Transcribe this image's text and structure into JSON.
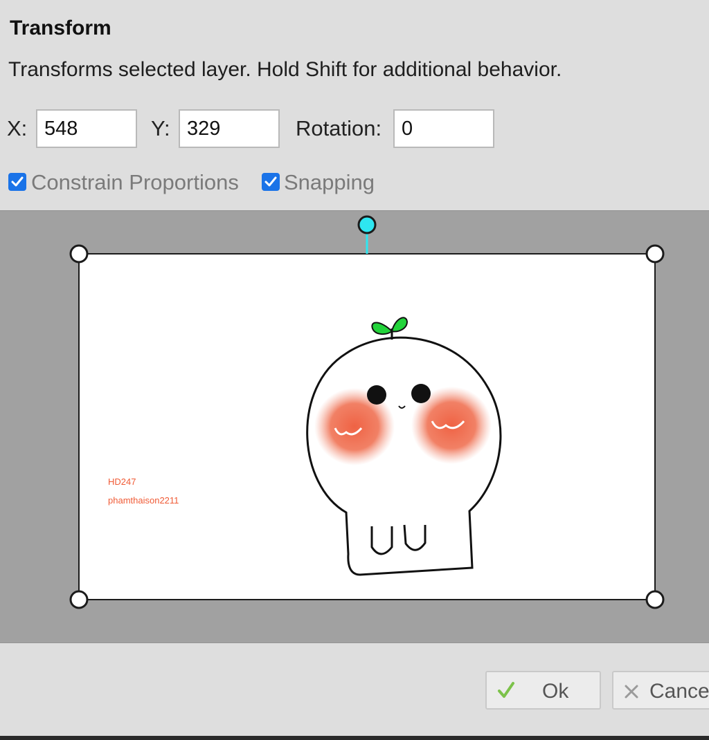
{
  "dialog": {
    "title": "Transform",
    "description": "Transforms selected layer. Hold Shift for additional behavior."
  },
  "fields": {
    "x_label": "X:",
    "x_value": "548",
    "y_label": "Y:",
    "y_value": "329",
    "rotation_label": "Rotation:",
    "rotation_value": "0"
  },
  "options": {
    "constrain_label": "Constrain Proportions",
    "constrain_checked": true,
    "snapping_label": "Snapping",
    "snapping_checked": true
  },
  "canvas": {
    "watermark_line1": "HD247",
    "watermark_line2": "phamthaison2211"
  },
  "buttons": {
    "ok_label": "Ok",
    "cancel_label": "Cance"
  },
  "colors": {
    "accent": "#1a73e8",
    "rotation_handle": "#2ee6f0",
    "blush": "#f0603f",
    "sprout": "#22d33a",
    "ok_check": "#7cc24a"
  }
}
